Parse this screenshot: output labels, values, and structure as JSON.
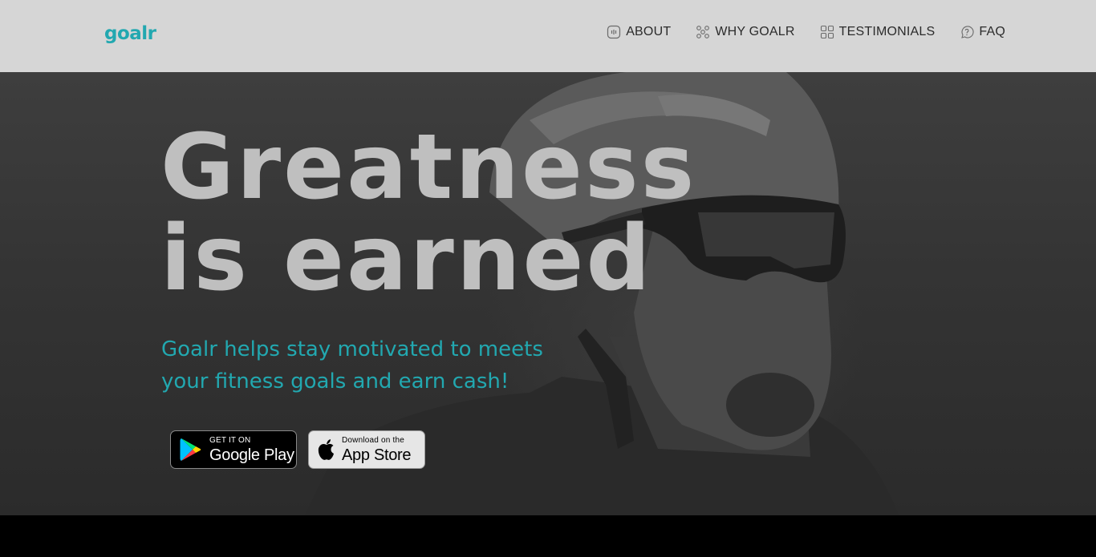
{
  "brand": {
    "name": "goalr",
    "accent": "#22a8b0"
  },
  "nav": {
    "items": [
      {
        "label": "ABOUT",
        "icon": "chat-icon"
      },
      {
        "label": "WHY GOALR",
        "icon": "network-icon"
      },
      {
        "label": "TESTIMONIALS",
        "icon": "grid-icon"
      },
      {
        "label": "FAQ",
        "icon": "help-icon"
      }
    ]
  },
  "hero": {
    "headline_line1": "Greatness",
    "headline_line2": "is earned",
    "subtitle": "Goalr helps stay motivated to meets your fitness goals and earn cash!"
  },
  "badges": {
    "google": {
      "small": "GET IT ON",
      "big": "Google Play",
      "icon": "google-play-icon"
    },
    "apple": {
      "small": "Download on the",
      "big": "App Store",
      "icon": "apple-icon"
    }
  }
}
